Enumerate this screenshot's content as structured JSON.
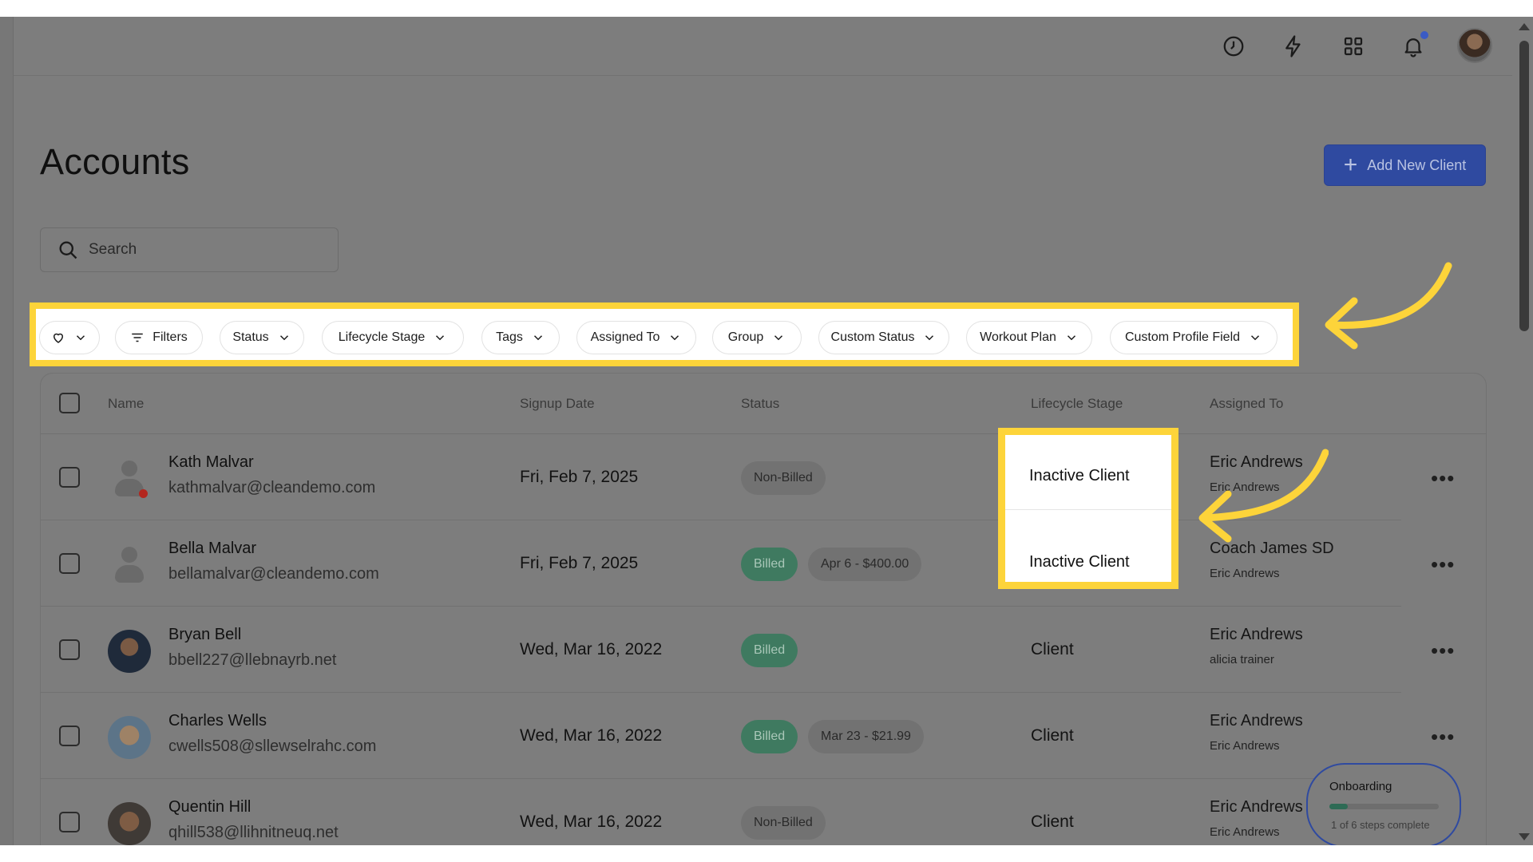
{
  "page": {
    "title": "Accounts",
    "add_button_label": "Add New Client",
    "search_placeholder": "Search"
  },
  "topbar": {
    "icons": [
      "history-icon",
      "lightning-icon",
      "apps-grid-icon",
      "bell-icon",
      "user-avatar"
    ]
  },
  "filters": {
    "favorites_icon": "heart-icon",
    "items": [
      {
        "label": "Filters"
      },
      {
        "label": "Status"
      },
      {
        "label": "Lifecycle Stage"
      },
      {
        "label": "Tags"
      },
      {
        "label": "Assigned To"
      },
      {
        "label": "Group"
      },
      {
        "label": "Custom Status"
      },
      {
        "label": "Workout Plan"
      },
      {
        "label": "Custom Profile Field"
      }
    ]
  },
  "table": {
    "headers": {
      "name": "Name",
      "signup": "Signup Date",
      "status": "Status",
      "lifecycle": "Lifecycle Stage",
      "assigned": "Assigned To"
    },
    "rows": [
      {
        "name": "Kath Malvar",
        "email": "kathmalvar@cleandemo.com",
        "date": "Fri, Feb 7, 2025",
        "status": "Non-Billed",
        "billing": "",
        "lifecycle": "Inactive Client",
        "assigned_primary": "Eric Andrews",
        "assigned_secondary": "Eric Andrews"
      },
      {
        "name": "Bella Malvar",
        "email": "bellamalvar@cleandemo.com",
        "date": "Fri, Feb 7, 2025",
        "status": "Billed",
        "billing": "Apr 6 - $400.00",
        "lifecycle": "Inactive Client",
        "assigned_primary": "Coach James SD",
        "assigned_secondary": "Eric Andrews"
      },
      {
        "name": "Bryan Bell",
        "email": "bbell227@llebnayrb.net",
        "date": "Wed, Mar 16, 2022",
        "status": "Billed",
        "billing": "",
        "lifecycle": "Client",
        "assigned_primary": "Eric Andrews",
        "assigned_secondary": "alicia trainer"
      },
      {
        "name": "Charles Wells",
        "email": "cwells508@sllewselrahc.com",
        "date": "Wed, Mar 16, 2022",
        "status": "Billed",
        "billing": "Mar 23 - $21.99",
        "lifecycle": "Client",
        "assigned_primary": "Eric Andrews",
        "assigned_secondary": "Eric Andrews"
      },
      {
        "name": "Quentin Hill",
        "email": "qhill538@llihnitneuq.net",
        "date": "Wed, Mar 16, 2022",
        "status": "Non-Billed",
        "billing": "",
        "lifecycle": "Client",
        "assigned_primary": "Eric Andrews",
        "assigned_secondary": "Eric Andrews"
      }
    ]
  },
  "onboarding": {
    "title": "Onboarding",
    "progress_text": "1 of 6 steps complete",
    "progress_fraction": 0.1667
  },
  "colors": {
    "highlight": "#fdd43a",
    "primary": "#2f4aa0",
    "billed": "#3f7a60"
  }
}
